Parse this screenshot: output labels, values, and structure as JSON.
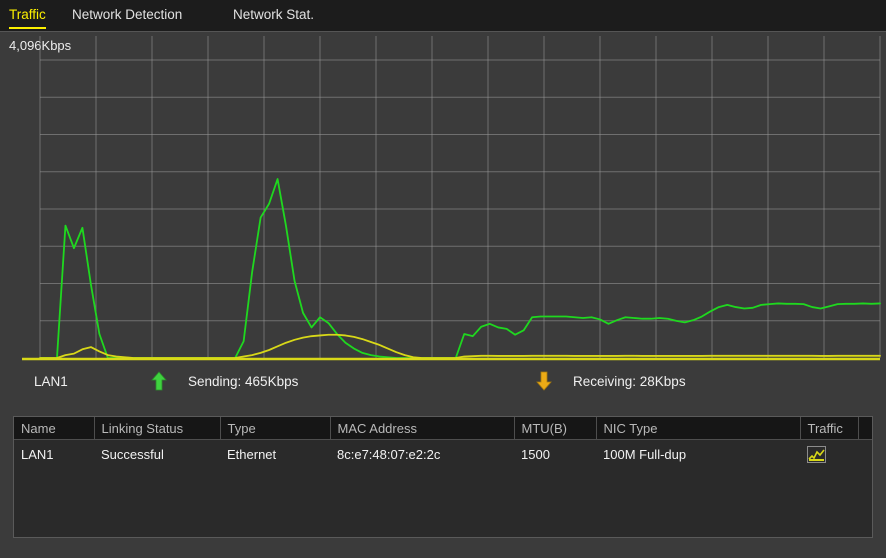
{
  "tabs": [
    {
      "id": "traffic",
      "label": "Traffic",
      "active": true
    },
    {
      "id": "network-detection",
      "label": "Network Detection",
      "active": false
    },
    {
      "id": "network-stat",
      "label": "Network Stat.",
      "active": false
    }
  ],
  "chart_axis_label": "4,096Kbps",
  "legend": {
    "interface": "LAN1",
    "sending_label": "Sending: 465Kbps",
    "receiving_label": "Receiving: 28Kbps",
    "up_arrow_icon": "arrow-up-icon",
    "down_arrow_icon": "arrow-down-icon"
  },
  "table": {
    "headers": [
      "Name",
      "Linking Status",
      "Type",
      "MAC Address",
      "MTU(B)",
      "NIC Type",
      "Traffic",
      ""
    ],
    "rows": [
      {
        "name": "LAN1",
        "linking_status": "Successful",
        "type": "Ethernet",
        "mac_address": "8c:e7:48:07:e2:2c",
        "mtu": "1500",
        "nic_type": "100M Full-dup",
        "traffic_icon": "traffic-chart-icon"
      }
    ]
  },
  "colors": {
    "accent": "#fcf000",
    "sending_line": "#1fd81f",
    "receiving_line": "#d8d818",
    "grid": "#9a9a9a",
    "panel_bg": "#3b3b3b",
    "tabbar_bg": "#1c1c1c",
    "table_header_bg": "#161616",
    "table_row_bg": "#2a2a2a"
  },
  "chart_data": {
    "type": "line",
    "title": "",
    "xlabel": "",
    "ylabel": "Kbps",
    "ylim": [
      0,
      4096
    ],
    "grid": true,
    "legend_position": "below",
    "x_gridlines": 15,
    "y_gridlines": 8,
    "x": [
      0,
      1,
      2,
      3,
      4,
      5,
      6,
      7,
      8,
      9,
      10,
      11,
      12,
      13,
      14,
      15,
      16,
      17,
      18,
      19,
      20,
      21,
      22,
      23,
      24,
      25,
      26,
      27,
      28,
      29,
      30,
      31,
      32,
      33,
      34,
      35,
      36,
      37,
      38,
      39,
      40,
      41,
      42,
      43,
      44,
      45,
      46,
      47,
      48,
      49,
      50,
      51,
      52,
      53,
      54,
      55,
      56,
      57,
      58,
      59,
      60,
      61,
      62,
      63,
      64,
      65,
      66,
      67,
      68,
      69,
      70,
      71,
      72,
      73,
      74,
      75,
      76,
      77,
      78,
      79,
      80,
      81,
      82,
      83,
      84,
      85,
      86,
      87,
      88,
      89,
      90,
      91,
      92,
      93,
      94,
      95,
      96,
      97,
      98,
      99
    ],
    "series": [
      {
        "name": "Sending",
        "color": "#1fd81f",
        "values": [
          0,
          0,
          0,
          1820,
          1510,
          1790,
          1010,
          330,
          0,
          0,
          0,
          0,
          0,
          0,
          0,
          0,
          0,
          0,
          0,
          0,
          0,
          0,
          0,
          0,
          230,
          1180,
          1930,
          2120,
          2460,
          1810,
          1060,
          620,
          420,
          560,
          480,
          330,
          210,
          130,
          70,
          40,
          20,
          10,
          0,
          0,
          0,
          0,
          0,
          0,
          0,
          0,
          330,
          300,
          430,
          470,
          420,
          400,
          320,
          380,
          560,
          570,
          570,
          570,
          570,
          560,
          550,
          560,
          530,
          470,
          520,
          560,
          550,
          540,
          540,
          550,
          540,
          510,
          490,
          520,
          570,
          640,
          700,
          730,
          700,
          680,
          690,
          730,
          740,
          750,
          745,
          745,
          740,
          700,
          680,
          710,
          740,
          745,
          745,
          750,
          745,
          750
        ]
      },
      {
        "name": "Receiving",
        "color": "#d8d818",
        "values": [
          0,
          0,
          0,
          40,
          60,
          120,
          150,
          90,
          40,
          20,
          10,
          0,
          0,
          0,
          0,
          0,
          0,
          0,
          0,
          0,
          0,
          0,
          0,
          0,
          20,
          40,
          70,
          110,
          160,
          210,
          250,
          280,
          300,
          310,
          320,
          320,
          310,
          290,
          260,
          220,
          180,
          130,
          80,
          40,
          10,
          0,
          0,
          0,
          0,
          0,
          20,
          25,
          30,
          30,
          28,
          28,
          28,
          28,
          30,
          30,
          30,
          30,
          30,
          28,
          28,
          28,
          28,
          28,
          28,
          30,
          30,
          28,
          28,
          28,
          28,
          28,
          28,
          28,
          28,
          30,
          30,
          30,
          30,
          30,
          30,
          30,
          30,
          30,
          30,
          30,
          30,
          30,
          28,
          28,
          30,
          30,
          30,
          30,
          30,
          30
        ]
      }
    ]
  }
}
